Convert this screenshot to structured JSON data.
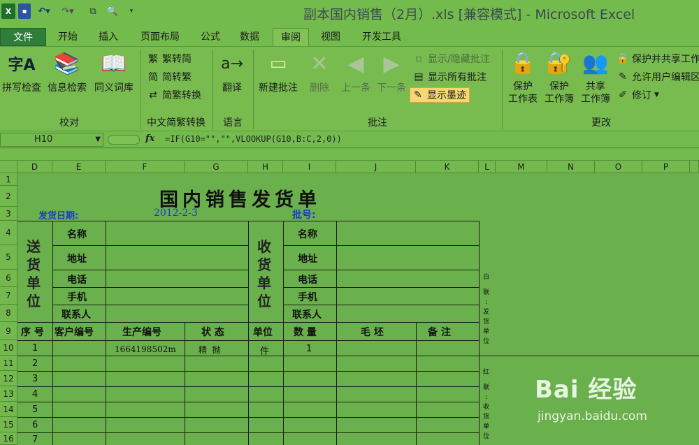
{
  "titlebar": {
    "title": "副本国内销售（2月）.xls  [兼容模式] - Microsoft Excel",
    "excel_icon": "X",
    "save_icon": "▪",
    "undo_icon": "↶▾",
    "redo_icon": "↷▾",
    "copy_icon": "⧉",
    "preview_icon": "🔍",
    "more_icon": "▾"
  },
  "tabs": [
    "文件",
    "开始",
    "插入",
    "页面布局",
    "公式",
    "数据",
    "审阅",
    "视图",
    "开发工具"
  ],
  "ribbon": {
    "proofing": {
      "label": "校对",
      "spell": "拼写检查",
      "research": "信息检索",
      "thesaurus": "同义词库"
    },
    "chinese": {
      "label": "中文简繁转换",
      "to_simplified": "繁转简",
      "to_traditional": "简转繁",
      "convert": "简繁转换"
    },
    "language": {
      "label": "语言",
      "translate": "翻译"
    },
    "comments": {
      "label": "批注",
      "new": "新建批注",
      "delete": "删除",
      "prev": "上一条",
      "next": "下一条",
      "show_hide": "显示/隐藏批注",
      "show_all": "显示所有批注",
      "show_ink": "显示墨迹"
    },
    "changes": {
      "label": "更改",
      "protect_sheet": [
        "保护",
        "工作表"
      ],
      "protect_book": [
        "保护",
        "工作簿"
      ],
      "share": [
        "共享",
        "工作簿"
      ],
      "protect_share": "保护并共享工作",
      "allow_edit": "允许用户编辑区",
      "track": "修订"
    }
  },
  "formula_bar": {
    "name_box": "H10",
    "fx": "fx",
    "formula": "=IF(G10=\"\",\"\",VLOOKUP(G10,B:C,2,0))"
  },
  "columns": [
    "D",
    "E",
    "F",
    "G",
    "H",
    "I",
    "J",
    "K",
    "L",
    "M",
    "N",
    "O",
    "P"
  ],
  "rows": [
    "1",
    "2",
    "3",
    "4",
    "5",
    "6",
    "7",
    "8",
    "9",
    "10",
    "11",
    "12",
    "13",
    "14",
    "15",
    "16"
  ],
  "sheet": {
    "title": "国内销售发货单",
    "date_label": "发货日期:",
    "date_value": "2012-2-3",
    "batch_label": "批号:",
    "sender_vertical": [
      "送",
      "货",
      "单",
      "位"
    ],
    "receiver_vertical": [
      "收",
      "货",
      "单",
      "位"
    ],
    "field_labels": [
      "名称",
      "地址",
      "电话",
      "手机",
      "联系人"
    ],
    "table_headers": [
      "序 号",
      "客户编号",
      "生产编号",
      "状 态",
      "单位",
      "数 量",
      "毛 坯",
      "备 注"
    ],
    "row10": {
      "seq": "1",
      "prod_no": "1664198502m",
      "status": "精  抛",
      "unit": "件",
      "qty": "1"
    },
    "seq_numbers": [
      "2",
      "3",
      "4",
      "5",
      "6",
      "7"
    ],
    "side_note_white": [
      "白",
      "联",
      ":",
      "发",
      "货",
      "单",
      "位"
    ],
    "side_note_red": [
      "红",
      "联",
      ":",
      "收",
      "货",
      "单",
      "位"
    ]
  },
  "watermark": {
    "brand": "Bai 经验",
    "url": "jingyan.baidu.com"
  }
}
